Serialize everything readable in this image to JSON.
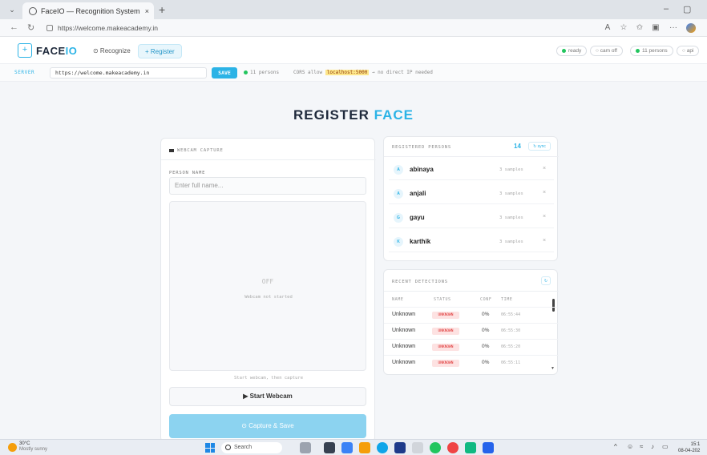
{
  "browser": {
    "tab_title": "FaceIO — Recognition System",
    "tab_close": "×",
    "new_tab": "+",
    "menu_glyph": "⌄",
    "url": "https://welcome.makeacademy.in",
    "minimize": "–",
    "maximize": "▢",
    "toolbar_more": "···"
  },
  "app": {
    "logo_a": "FACE",
    "logo_b": "IO",
    "logo_glyph": "+",
    "nav": {
      "recognize": "⊙ Recognize",
      "register": "+ Register"
    },
    "status_pills": {
      "ready": "ready",
      "cam_off": "○ cam off",
      "persons": "11 persons",
      "api": "○ api"
    }
  },
  "server": {
    "label": "SERVER",
    "url": "https://welcome.makeacademy.in",
    "save": "SAVE",
    "status": "11 persons",
    "hint_pre": "CORS allow",
    "hint_hl": "localhost:5000",
    "hint_post": "→ no direct IP needed"
  },
  "page": {
    "title_a": "REGISTER",
    "title_b": "FACE"
  },
  "webcam": {
    "header": "WEBCAM CAPTURE",
    "person_label": "PERSON NAME",
    "name_placeholder": "Enter full name...",
    "off_icon": "OFF",
    "off_text": "Webcam not started",
    "cap_hint": "Start webcam, then capture",
    "start_btn": "▶ Start Webcam",
    "capture_btn": "⊙ Capture & Save"
  },
  "persons": {
    "header": "REGISTERED PERSONS",
    "count": "14",
    "refresh": "↻ sync",
    "items": [
      {
        "initial": "A",
        "name": "abinaya",
        "samples": "3 samples",
        "remove": "×"
      },
      {
        "initial": "A",
        "name": "anjali",
        "samples": "3 samples",
        "remove": "×"
      },
      {
        "initial": "G",
        "name": "gayu",
        "samples": "3 samples",
        "remove": "×"
      },
      {
        "initial": "K",
        "name": "karthik",
        "samples": "3 samples",
        "remove": "×"
      }
    ]
  },
  "detections": {
    "header": "RECENT DETECTIONS",
    "clear": "↻",
    "columns": {
      "name": "NAME",
      "status": "STATUS",
      "conf": "CONF",
      "time": "TIME"
    },
    "rows": [
      {
        "name": "Unknown",
        "status": "UNKNOWN",
        "conf": "0%",
        "time": "06:55:44"
      },
      {
        "name": "Unknown",
        "status": "UNKNOWN",
        "conf": "0%",
        "time": "06:55:30"
      },
      {
        "name": "Unknown",
        "status": "UNKNOWN",
        "conf": "0%",
        "time": "06:55:20"
      },
      {
        "name": "Unknown",
        "status": "UNKNOWN",
        "conf": "0%",
        "time": "06:55:11"
      }
    ]
  },
  "taskbar": {
    "temp": "30°C",
    "weather": "Mostly sunny",
    "search": "Search",
    "time": "15:1",
    "date": "08-04-202"
  }
}
